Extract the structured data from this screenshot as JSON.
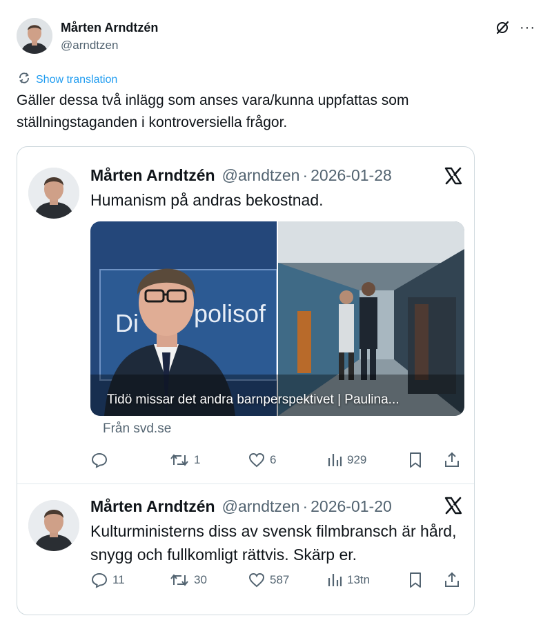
{
  "post": {
    "author_name": "Mårten Arndtzén",
    "author_handle": "@arndtzen",
    "icons": [
      "grok-icon",
      "more-icon"
    ],
    "more_label": "···",
    "show_translation": "Show translation",
    "text": "Gäller dessa två inlägg som anses vara/kunna uppfattas som ställningstaganden i kontroversiella frågor."
  },
  "quotes": [
    {
      "author_name": "Mårten Arndtzén",
      "handle": "@arndtzen",
      "separator": "·",
      "date": "2026-01-28",
      "text": "Humanism på andras bekostnad.",
      "media_sign_text": "polisof",
      "media_sign_text_left": "Di",
      "link_caption": "Tidö missar det andra barnperspektivet | Paulina...",
      "source": "Från svd.se",
      "replies": "",
      "reposts": "1",
      "likes": "6",
      "views": "929"
    },
    {
      "author_name": "Mårten Arndtzén",
      "handle": "@arndtzen",
      "separator": "·",
      "date": "2026-01-20",
      "text": "Kulturministerns diss av svensk filmbransch är hård, snygg och fullkomligt rättvis. Skärp er.",
      "replies": "11",
      "reposts": "30",
      "likes": "587",
      "views": "13tn"
    }
  ],
  "colors": {
    "link_blue": "#1d9bf0",
    "secondary_text": "#536471",
    "primary_text": "#0f1419",
    "border": "#cfd9de"
  }
}
